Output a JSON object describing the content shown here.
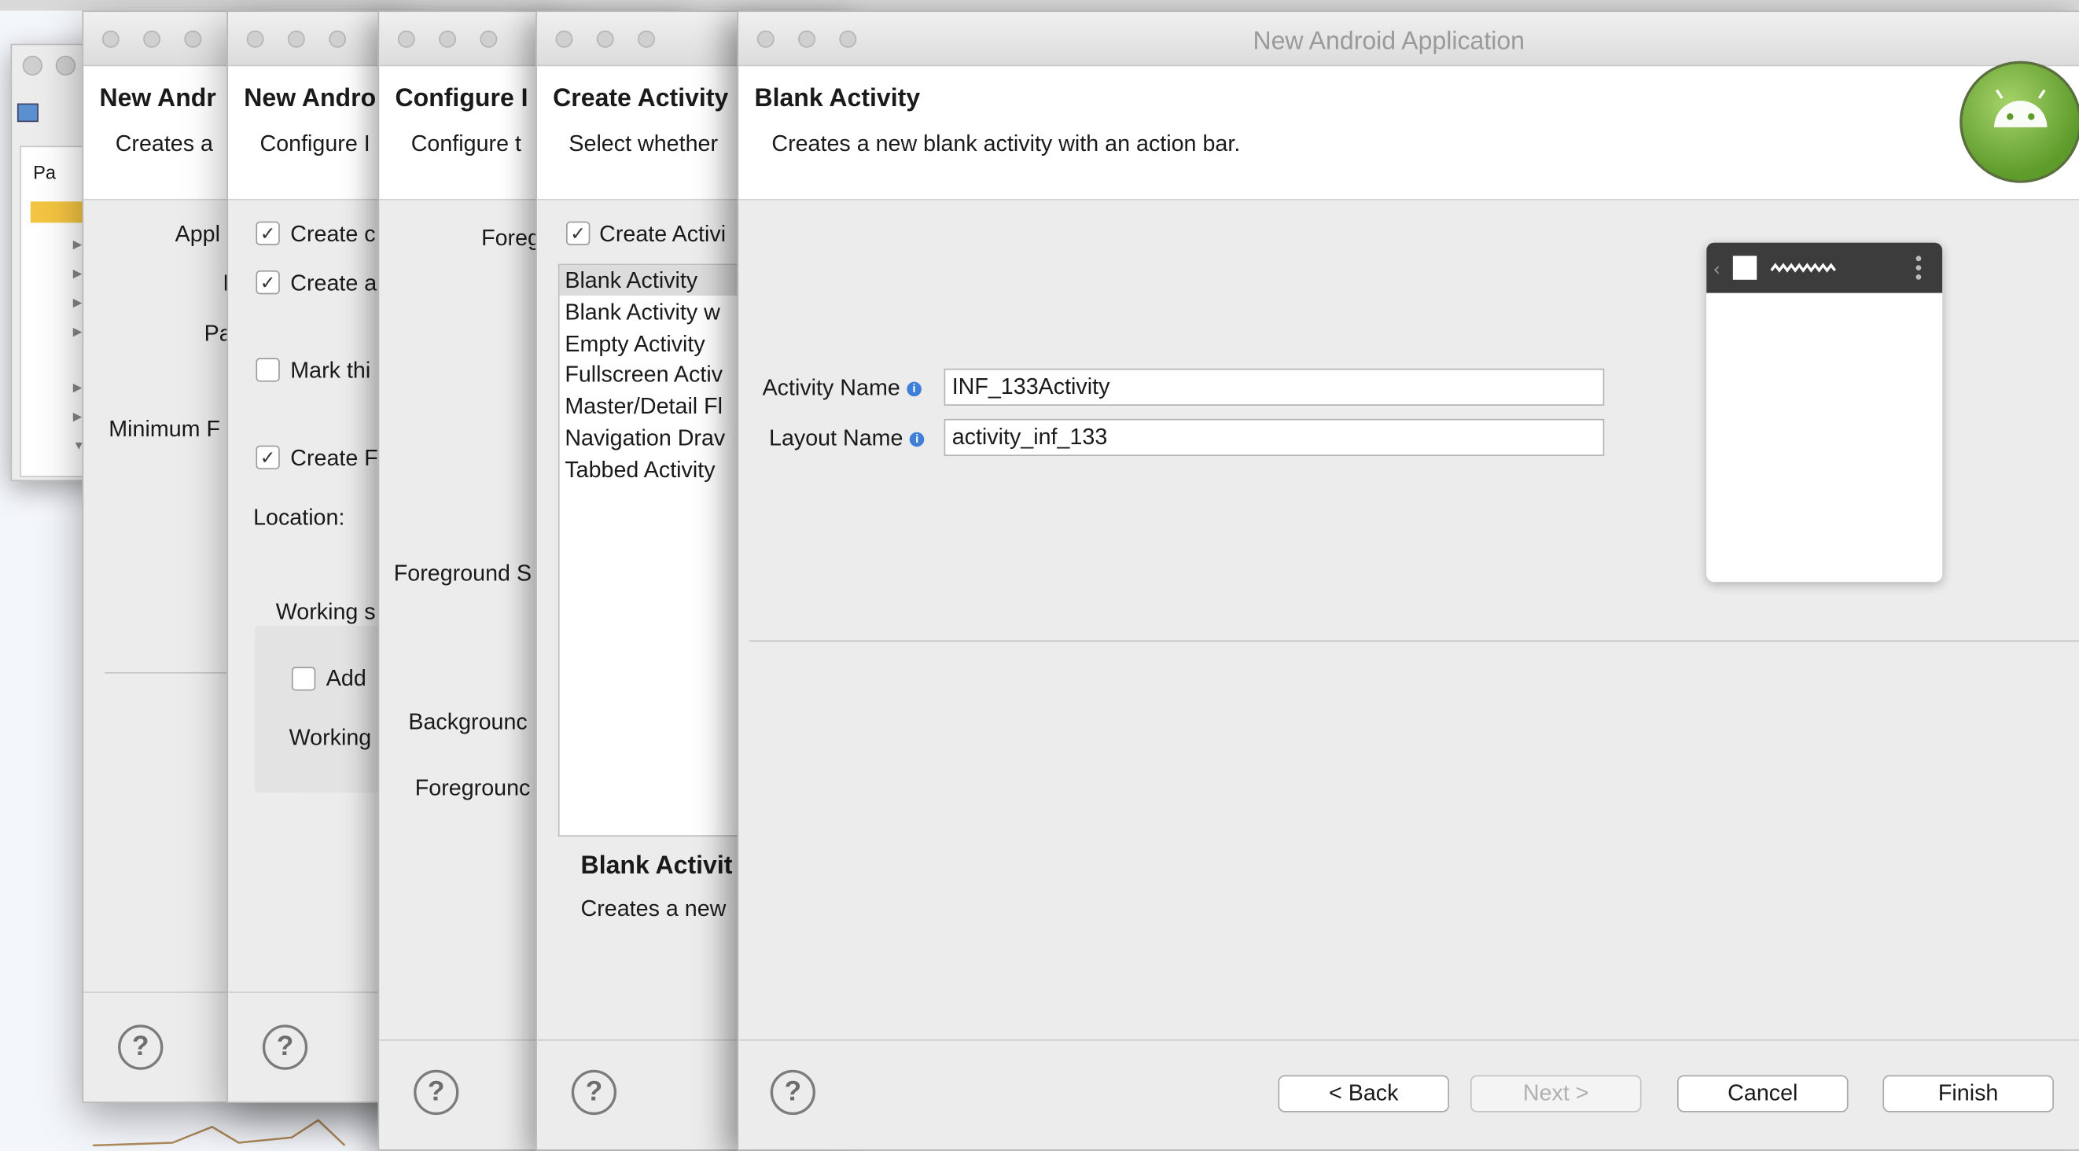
{
  "window_title": "New Android Application",
  "eclipse": {
    "panel_tab": "Pa"
  },
  "dialog1": {
    "title": "New Andr",
    "desc": "Creates a",
    "labels": [
      "Appl",
      "I",
      "Pa",
      "Minimum F"
    ]
  },
  "dialog2": {
    "title": "New Andro",
    "desc": "Configure I",
    "checkboxes": [
      {
        "label": "Create c",
        "checked": true
      },
      {
        "label": "Create a",
        "checked": true
      },
      {
        "label": "Mark thi",
        "checked": false
      },
      {
        "label": "Create F",
        "checked": true
      }
    ],
    "location_label": "Location:",
    "working_sets_label": "Working s",
    "add_label": "Add",
    "working_label": "Working"
  },
  "dialog3": {
    "title": "Configure I",
    "desc": "Configure t",
    "labels": [
      "Foreg",
      "Foreground S",
      "Backgrounc",
      "Foregrounc"
    ]
  },
  "dialog4": {
    "title": "Create Activity",
    "desc": "Select whether",
    "create_activity_label": "Create Activi",
    "activities": [
      "Blank Activity",
      "Blank Activity w",
      "Empty Activity",
      "Fullscreen Activ",
      "Master/Detail Fl",
      "Navigation Drav",
      "Tabbed Activity"
    ],
    "selected_index": 0,
    "detail_title": "Blank Activit",
    "detail_desc": "Creates a new"
  },
  "main": {
    "title": "Blank Activity",
    "desc": "Creates a new blank activity with an action bar.",
    "activity_name_label": "Activity Name",
    "activity_name_value": "INF_133Activity",
    "layout_name_label": "Layout Name",
    "layout_name_value": "activity_inf_133",
    "buttons": {
      "back": "< Back",
      "next": "Next >",
      "cancel": "Cancel",
      "finish": "Finish"
    }
  },
  "icons": {
    "help": "?",
    "info": "i",
    "check": "✓",
    "apple": ""
  }
}
